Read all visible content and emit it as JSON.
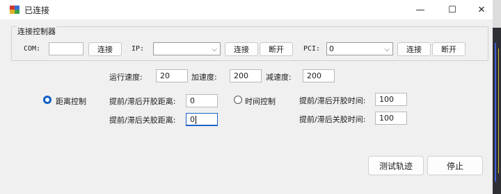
{
  "window": {
    "title": "已连接",
    "minimize": "—",
    "maximize": "☐",
    "close": "✕"
  },
  "group": {
    "title": "连接控制器",
    "com_label": "COM:",
    "com_value": "",
    "com_connect": "连接",
    "ip_label": "IP:",
    "ip_value": "",
    "ip_connect": "连接",
    "ip_disconnect": "断开",
    "pci_label": "PCI:",
    "pci_value": "0",
    "pci_connect": "连接",
    "pci_disconnect": "断开",
    "chevron": "⌵"
  },
  "speed": {
    "run_label": "运行速度:",
    "run_value": "20",
    "acc_label": "加速度:",
    "acc_value": "200",
    "dec_label": "减速度:",
    "dec_value": "200"
  },
  "distance": {
    "radio_label": "距离控制",
    "selected": true,
    "open_label": "提前/滞后开胶距离:",
    "open_value": "0",
    "close_label": "提前/滞后关胶距离:",
    "close_value": "0"
  },
  "time": {
    "radio_label": "时间控制",
    "selected": false,
    "open_label": "提前/滞后开胶时间:",
    "open_value": "100",
    "close_label": "提前/滞后关胶时间:",
    "close_value": "100"
  },
  "actions": {
    "test": "测试轨迹",
    "stop": "停止"
  },
  "colors": {
    "accent": "#0f5fc4",
    "window_bg": "#f0f0f0"
  }
}
